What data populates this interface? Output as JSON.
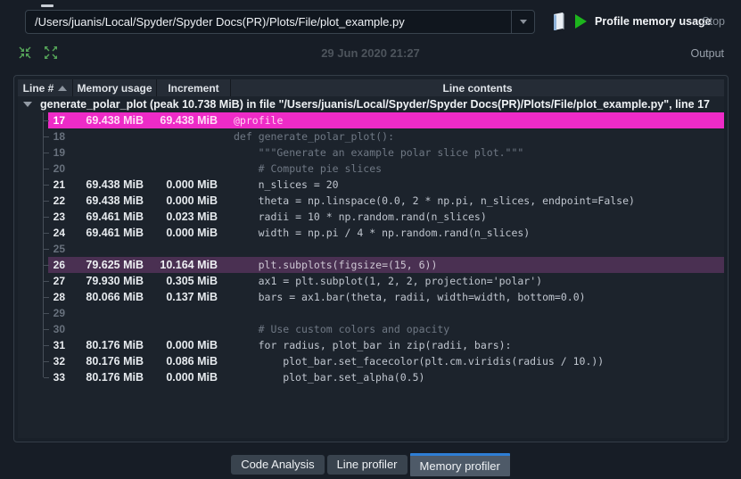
{
  "toolbar": {
    "path_value": "/Users/juanis/Local/Spyder/Spyder Docs(PR)/Plots/File/plot_example.py",
    "profile_button_label": "Profile memory usage",
    "stop_button_label": "Stop",
    "timestamp": "29 Jun 2020 21:27",
    "output_label": "Output",
    "icons": [
      "open-file-icon",
      "play-icon",
      "collapse-all-icon",
      "expand-all-icon"
    ]
  },
  "table": {
    "columns": [
      "Line #",
      "Memory usage",
      "Increment",
      "Line contents"
    ],
    "sort_column": "Line #",
    "root_label": "generate_polar_plot (peak 10.738 MiB) in file \"/Users/juanis/Local/Spyder/Spyder Docs(PR)/Plots/File/plot_example.py\", line 17",
    "rows": [
      {
        "line": "17",
        "mem": "69.438 MiB",
        "inc": "69.438 MiB",
        "code": "@profile",
        "indent": 0,
        "style": "magenta"
      },
      {
        "line": "18",
        "mem": "",
        "inc": "",
        "code": "def generate_polar_plot():",
        "indent": 0,
        "style": "dim"
      },
      {
        "line": "19",
        "mem": "",
        "inc": "",
        "code": "\"\"\"Generate an example polar slice plot.\"\"\"",
        "indent": 4,
        "style": "dim"
      },
      {
        "line": "20",
        "mem": "",
        "inc": "",
        "code": "# Compute pie slices",
        "indent": 4,
        "style": "dim"
      },
      {
        "line": "21",
        "mem": "69.438 MiB",
        "inc": "0.000 MiB",
        "code": "n_slices = 20",
        "indent": 4,
        "style": "normal"
      },
      {
        "line": "22",
        "mem": "69.438 MiB",
        "inc": "0.000 MiB",
        "code": "theta = np.linspace(0.0, 2 * np.pi, n_slices, endpoint=False)",
        "indent": 4,
        "style": "normal"
      },
      {
        "line": "23",
        "mem": "69.461 MiB",
        "inc": "0.023 MiB",
        "code": "radii = 10 * np.random.rand(n_slices)",
        "indent": 4,
        "style": "normal"
      },
      {
        "line": "24",
        "mem": "69.461 MiB",
        "inc": "0.000 MiB",
        "code": "width = np.pi / 4 * np.random.rand(n_slices)",
        "indent": 4,
        "style": "normal"
      },
      {
        "line": "25",
        "mem": "",
        "inc": "",
        "code": "",
        "indent": 0,
        "style": "dim"
      },
      {
        "line": "26",
        "mem": "79.625 MiB",
        "inc": "10.164 MiB",
        "code": "plt.subplots(figsize=(15, 6))",
        "indent": 4,
        "style": "plum"
      },
      {
        "line": "27",
        "mem": "79.930 MiB",
        "inc": "0.305 MiB",
        "code": "ax1 = plt.subplot(1, 2, 2, projection='polar')",
        "indent": 4,
        "style": "normal"
      },
      {
        "line": "28",
        "mem": "80.066 MiB",
        "inc": "0.137 MiB",
        "code": "bars = ax1.bar(theta, radii, width=width, bottom=0.0)",
        "indent": 4,
        "style": "normal"
      },
      {
        "line": "29",
        "mem": "",
        "inc": "",
        "code": "",
        "indent": 0,
        "style": "dim"
      },
      {
        "line": "30",
        "mem": "",
        "inc": "",
        "code": "# Use custom colors and opacity",
        "indent": 4,
        "style": "dim"
      },
      {
        "line": "31",
        "mem": "80.176 MiB",
        "inc": "0.000 MiB",
        "code": "for radius, plot_bar in zip(radii, bars):",
        "indent": 4,
        "style": "normal"
      },
      {
        "line": "32",
        "mem": "80.176 MiB",
        "inc": "0.086 MiB",
        "code": "plot_bar.set_facecolor(plt.cm.viridis(radius / 10.))",
        "indent": 8,
        "style": "normal"
      },
      {
        "line": "33",
        "mem": "80.176 MiB",
        "inc": "0.000 MiB",
        "code": "plot_bar.set_alpha(0.5)",
        "indent": 8,
        "style": "normal"
      }
    ]
  },
  "tabs": [
    {
      "label": "Code Analysis",
      "active": false
    },
    {
      "label": "Line profiler",
      "active": false
    },
    {
      "label": "Memory profiler",
      "active": true
    }
  ],
  "colors": {
    "magenta_highlight": "#ee2bc7",
    "plum_highlight": "#4a3052",
    "tab_accent": "#2e7ed5",
    "play_green": "#1db51d",
    "tree_icon_green": "#55a459"
  }
}
